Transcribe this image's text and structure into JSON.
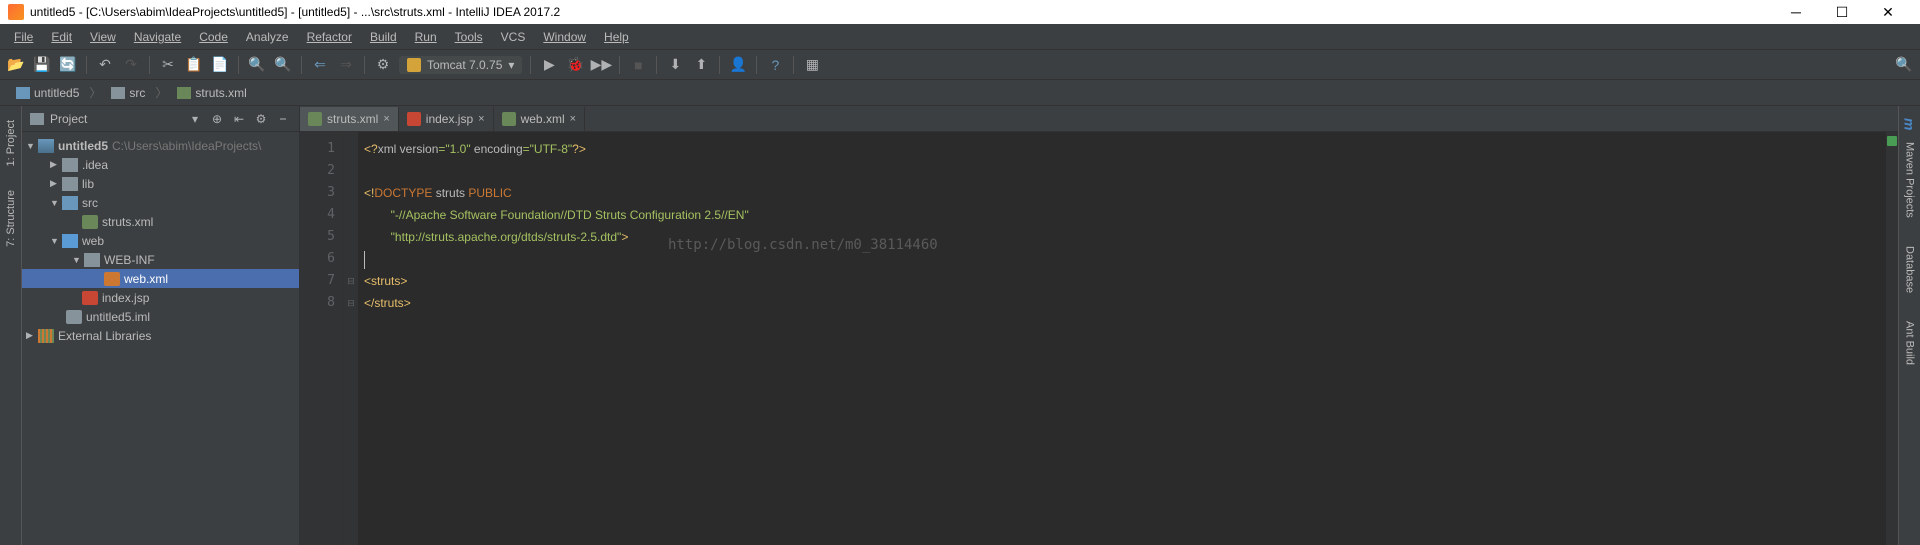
{
  "window": {
    "title": "untitled5 - [C:\\Users\\abim\\IdeaProjects\\untitled5] - [untitled5] - ...\\src\\struts.xml - IntelliJ IDEA 2017.2"
  },
  "menu": [
    "File",
    "Edit",
    "View",
    "Navigate",
    "Code",
    "Analyze",
    "Refactor",
    "Build",
    "Run",
    "Tools",
    "VCS",
    "Window",
    "Help"
  ],
  "toolbar": {
    "run_config": "Tomcat 7.0.75",
    "dropdown_caret": "▾"
  },
  "breadcrumb": [
    {
      "icon": "module",
      "label": "untitled5"
    },
    {
      "icon": "folder",
      "label": "src"
    },
    {
      "icon": "sxml",
      "label": "struts.xml"
    }
  ],
  "panel": {
    "title": "Project"
  },
  "tree": {
    "root": {
      "label": "untitled5",
      "path": "C:\\Users\\abim\\IdeaProjects\\"
    },
    "idea": ".idea",
    "lib": "lib",
    "src": "src",
    "struts_xml": "struts.xml",
    "web": "web",
    "webinf": "WEB-INF",
    "web_xml": "web.xml",
    "index_jsp": "index.jsp",
    "iml": "untitled5.iml",
    "ext_libs": "External Libraries"
  },
  "tabs": [
    {
      "label": "struts.xml",
      "icon": "sxml",
      "active": true
    },
    {
      "label": "index.jsp",
      "icon": "jsp",
      "active": false
    },
    {
      "label": "web.xml",
      "icon": "xml",
      "active": false
    }
  ],
  "code": {
    "l1_a": "<?",
    "l1_b": "xml version",
    "l1_c": "=",
    "l1_d": "\"1.0\"",
    "l1_e": " encoding",
    "l1_f": "=",
    "l1_g": "\"UTF-8\"",
    "l1_h": "?>",
    "l3_a": "<!",
    "l3_b": "DOCTYPE",
    "l3_c": " struts ",
    "l3_d": "PUBLIC",
    "l4": "        \"-//Apache Software Foundation//DTD Struts Configuration 2.5//EN\"",
    "l5": "        \"http://struts.apache.org/dtds/struts-2.5.dtd\"",
    "l5_end": ">",
    "l7_a": "<",
    "l7_b": "struts",
    "l7_c": ">",
    "l8_a": "</",
    "l8_b": "struts",
    "l8_c": ">"
  },
  "watermark": "http://blog.csdn.net/m0_38114460",
  "left_rail": [
    "1: Project",
    "7: Structure"
  ],
  "right_rail": [
    "Maven Projects",
    "Database",
    "Ant Build"
  ],
  "line_numbers": [
    "1",
    "2",
    "3",
    "4",
    "5",
    "6",
    "7",
    "8"
  ]
}
